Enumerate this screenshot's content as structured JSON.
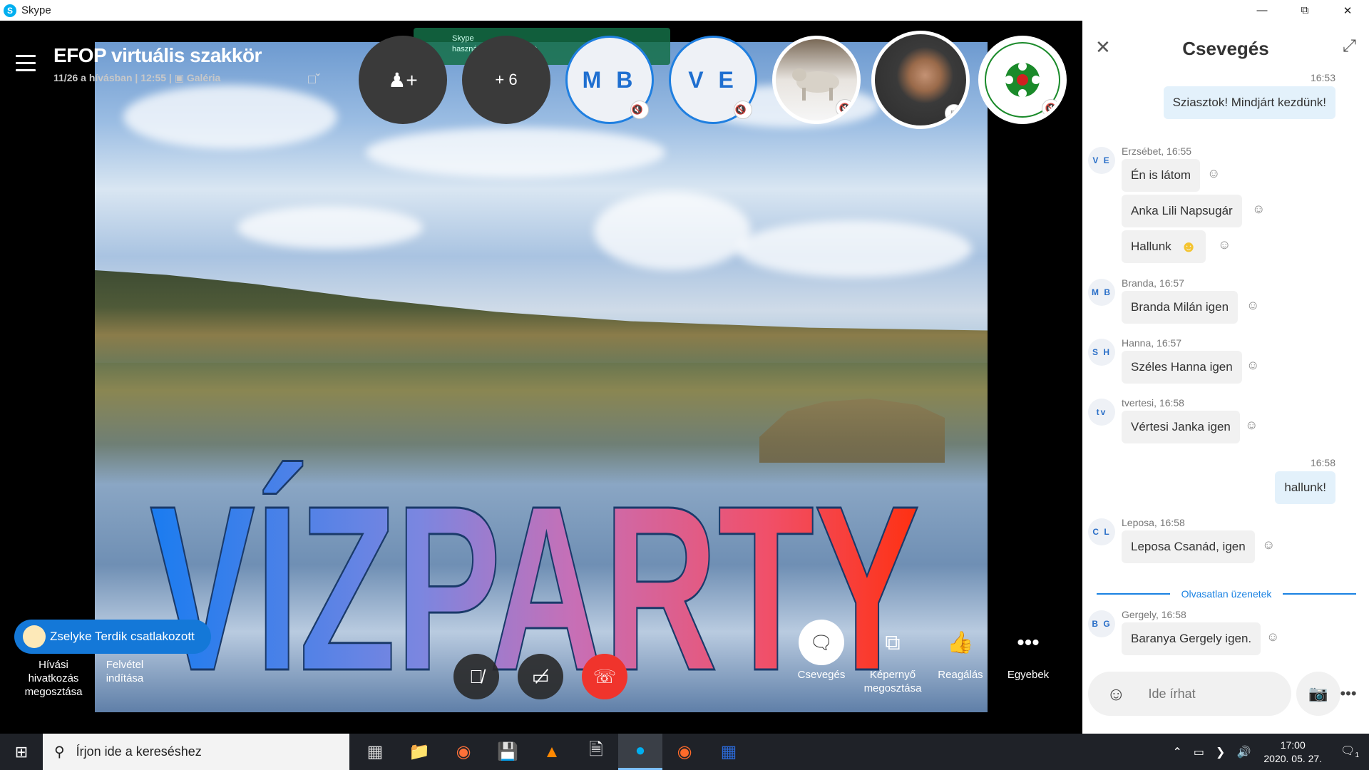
{
  "window": {
    "title": "Skype",
    "logo_glyph": "S"
  },
  "call": {
    "title": "EFOP virtuális szakkör",
    "subtitle": "11/26 a hívásban | 12:55 |",
    "view_mode": "Galéria",
    "toast_line1": "Skype",
    "toast_line2": "használja a webkamerát",
    "more_participants": "+ 6",
    "participants": [
      {
        "initials": "M B",
        "muted": true
      },
      {
        "initials": "V E",
        "muted": true
      }
    ],
    "banner_text": "VÍZPARTY",
    "joined_notice": "Zselyke Terdik csatlakozott",
    "left_controls": {
      "share_link": "Hívási hivatkozás megosztása",
      "record": "Felvétel indítása"
    },
    "right_controls": {
      "chat": "Csevegés",
      "screen_share": "Képernyő megosztása",
      "react": "Reagálás",
      "more": "Egyebek"
    },
    "org_logo_text": "RÓNAŐRZŐ TERMÉSZETVÉDELMI EGYESÜLET"
  },
  "chat": {
    "title": "Csevegés",
    "unread_label": "Olvasatlan üzenetek",
    "composer_placeholder": "Ide írhat",
    "messages": [
      {
        "time": "16:53",
        "text": "Sziasztok! Mindjárt kezdünk!"
      },
      {
        "initials": "V E",
        "meta": "Erzsébet, 16:55",
        "texts": [
          "Én is látom",
          "Anka Lili Napsugár",
          "Hallunk"
        ]
      },
      {
        "initials": "M B",
        "meta": "Branda, 16:57",
        "text": "Branda Milán igen"
      },
      {
        "initials": "S H",
        "meta": "Hanna, 16:57",
        "text": "Széles Hanna igen"
      },
      {
        "initials": "tv",
        "meta": "tvertesi, 16:58",
        "text": "Vértesi Janka igen"
      },
      {
        "time": "16:58",
        "text": "hallunk!"
      },
      {
        "initials": "C L",
        "meta": "Leposa, 16:58",
        "text": "Leposa Csanád, igen"
      },
      {
        "initials": "B G",
        "meta": "Gergely, 16:58",
        "text": "Baranya Gergely igen."
      }
    ]
  },
  "taskbar": {
    "search_placeholder": "Írjon ide a kereséshez",
    "time": "17:00",
    "date": "2020. 05. 27.",
    "notification_count": "1"
  }
}
